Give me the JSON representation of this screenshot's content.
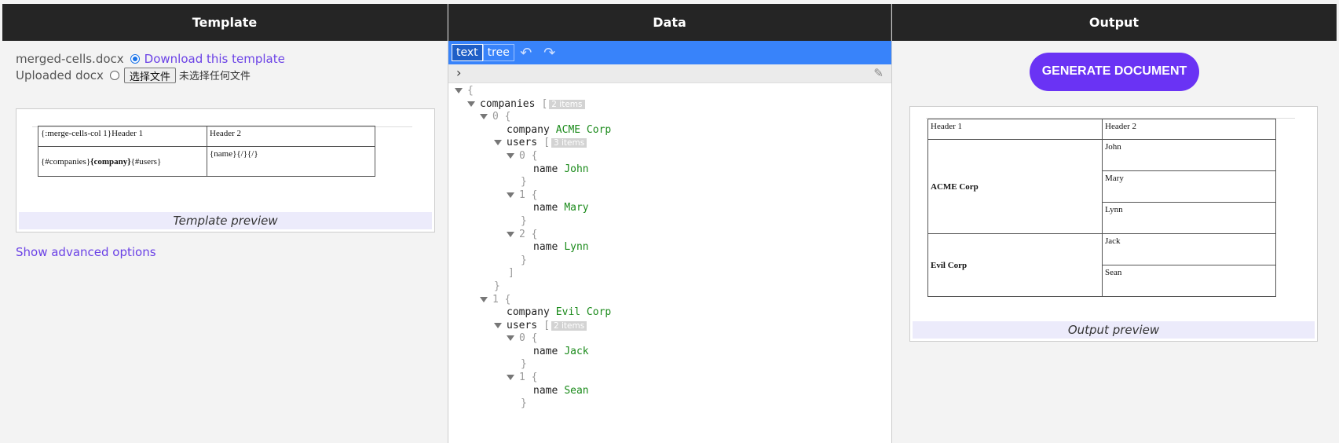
{
  "columns": {
    "template": "Template",
    "data": "Data",
    "output": "Output"
  },
  "template": {
    "filename": "merged-cells.docx",
    "download_label": "Download this template",
    "uploaded_label": "Uploaded docx",
    "file_button": "选择文件",
    "file_none": "未选择任何文件",
    "preview": {
      "r1c1": "{:merge-cells-col 1}Header 1",
      "r1c2": "Header 2",
      "r2c1_a": "{#companies}",
      "r2c1_b": "{company}",
      "r2c1_c": "{#users}",
      "r2c2": "{name}{/}{/}"
    },
    "caption": "Template preview",
    "advanced": "Show advanced options"
  },
  "data": {
    "modes": [
      "text",
      "tree"
    ],
    "undo_icon": "undo-icon",
    "redo_icon": "redo-icon",
    "tree": {
      "brace": "{",
      "close_brace": "}",
      "bracket": "[",
      "close_bracket": "]",
      "companies_key": "companies",
      "companies_count": "2 items",
      "c0_index": "0",
      "company_key": "company",
      "c0_company": "ACME Corp",
      "users_key": "users",
      "c0_users_count": "3 items",
      "name_key": "name",
      "u0_index": "0",
      "u0_name": "John",
      "u1_index": "1",
      "u1_name": "Mary",
      "u2_index": "2",
      "u2_name": "Lynn",
      "c1_index": "1",
      "c1_company": "Evil Corp",
      "c1_users_count": "2 items",
      "v0_index": "0",
      "v0_name": "Jack",
      "v1_index": "1",
      "v1_name": "Sean"
    }
  },
  "output": {
    "generate_button": "GENERATE DOCUMENT",
    "header1": "Header 1",
    "header2": "Header 2",
    "company1": "ACME Corp",
    "users1": [
      "John",
      "Mary",
      "Lynn"
    ],
    "company2": "Evil Corp",
    "users2": [
      "Jack",
      "Sean"
    ],
    "caption": "Output preview"
  }
}
